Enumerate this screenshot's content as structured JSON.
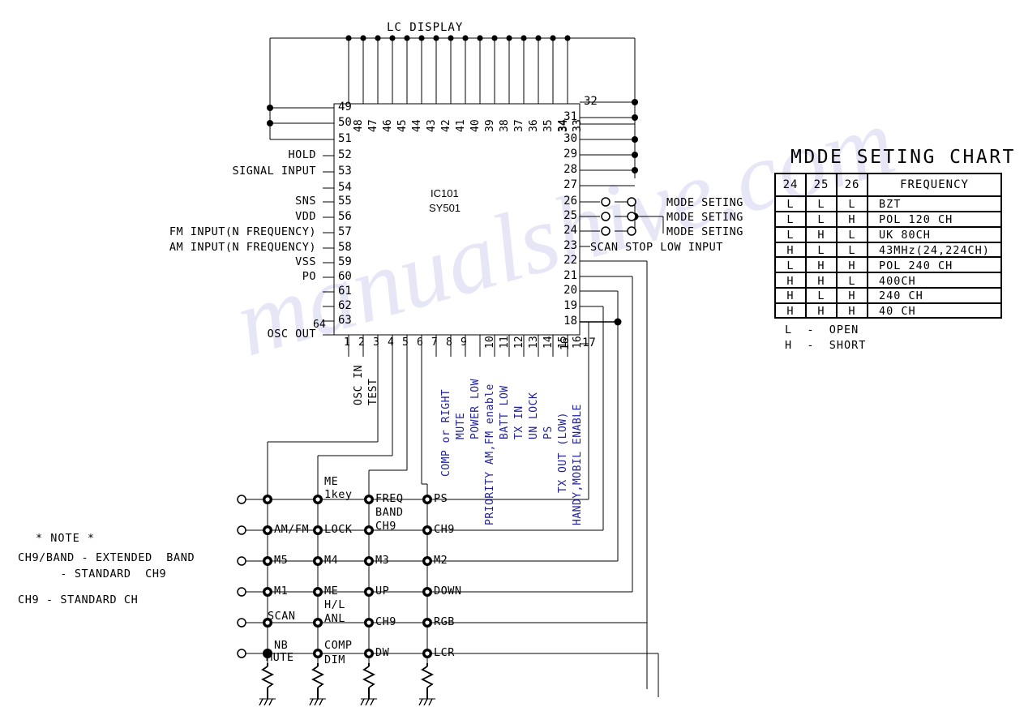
{
  "diagram": {
    "ic": {
      "ref": "IC101",
      "part": "SY501"
    },
    "top_bus_label": "LC DISPLAY"
  },
  "pins_left": [
    {
      "num": "49",
      "label": ""
    },
    {
      "num": "50",
      "label": ""
    },
    {
      "num": "51",
      "label": ""
    },
    {
      "num": "52",
      "label": "HOLD"
    },
    {
      "num": "53",
      "label": "SIGNAL INPUT"
    },
    {
      "num": "54",
      "label": ""
    },
    {
      "num": "55",
      "label": "SNS"
    },
    {
      "num": "56",
      "label": "VDD"
    },
    {
      "num": "57",
      "label": "FM INPUT(N FREQUENCY)"
    },
    {
      "num": "58",
      "label": "AM INPUT(N FREQUENCY)"
    },
    {
      "num": "59",
      "label": "VSS"
    },
    {
      "num": "60",
      "label": "PO"
    },
    {
      "num": "61",
      "label": ""
    },
    {
      "num": "62",
      "label": ""
    },
    {
      "num": "63",
      "label": ""
    },
    {
      "num": "64",
      "label": "OSC OUT"
    }
  ],
  "pins_top": [
    "48",
    "47",
    "46",
    "45",
    "44",
    "43",
    "42",
    "41",
    "40",
    "39",
    "38",
    "37",
    "36",
    "35",
    "34",
    "33"
  ],
  "pins_right": [
    {
      "num": "32",
      "label": ""
    },
    {
      "num": "31",
      "label": ""
    },
    {
      "num": "30",
      "label": ""
    },
    {
      "num": "29",
      "label": ""
    },
    {
      "num": "28",
      "label": ""
    },
    {
      "num": "27",
      "label": ""
    },
    {
      "num": "26",
      "label": "MODE SETING"
    },
    {
      "num": "25",
      "label": "MODE SETING"
    },
    {
      "num": "24",
      "label": "MODE SETING"
    },
    {
      "num": "23",
      "label": "SCAN STOP LOW INPUT"
    },
    {
      "num": "22",
      "label": ""
    },
    {
      "num": "21",
      "label": ""
    },
    {
      "num": "20",
      "label": ""
    },
    {
      "num": "19",
      "label": ""
    },
    {
      "num": "18",
      "label": ""
    },
    {
      "num": "17",
      "label": ""
    }
  ],
  "pins_bottom": [
    {
      "num": "1",
      "label": "OSC IN",
      "color": "black"
    },
    {
      "num": "2",
      "label": "TEST",
      "color": "black"
    },
    {
      "num": "3",
      "label": "",
      "color": "black"
    },
    {
      "num": "4",
      "label": "",
      "color": "black"
    },
    {
      "num": "5",
      "label": "",
      "color": "black"
    },
    {
      "num": "6",
      "label": "",
      "color": "black"
    },
    {
      "num": "7",
      "label": "COMP or RIGHT",
      "color": "blue"
    },
    {
      "num": "8",
      "label": "MUTE",
      "color": "blue"
    },
    {
      "num": "9",
      "label": "POWER LOW",
      "color": "blue"
    },
    {
      "num": "10",
      "label": "PRIORITY AM,FM enable",
      "color": "blue"
    },
    {
      "num": "11",
      "label": "BATT LOW",
      "color": "blue"
    },
    {
      "num": "12",
      "label": "TX IN",
      "color": "blue"
    },
    {
      "num": "13",
      "label": "UN LOCK",
      "color": "blue"
    },
    {
      "num": "14",
      "label": "PS",
      "color": "blue"
    },
    {
      "num": "15",
      "label": "TX OUT (LOW)",
      "color": "blue"
    },
    {
      "num": "16",
      "label": "HANDY,MOBIL ENABLE",
      "color": "blue"
    },
    {
      "num": "17",
      "label": "",
      "color": "black"
    }
  ],
  "keypad": {
    "rows": [
      [
        "",
        "ME\n1key",
        "FREQ",
        "PS"
      ],
      [
        "AM/FM",
        "LOCK",
        "BAND\nCH9",
        "CH9"
      ],
      [
        "M5",
        "M4",
        "M3",
        "M2"
      ],
      [
        "M1",
        "ME",
        "UP",
        "DOWN"
      ],
      [
        "SCAN",
        "H/L\nANL",
        "CH9",
        "RGB"
      ],
      [
        "NB\nMUTE",
        "COMP\nDIM",
        "DW",
        "LCR"
      ]
    ]
  },
  "note": {
    "title": "* NOTE *",
    "lines": [
      "CH9/BAND - EXTENDED  BAND",
      "      - STANDARD  CH9",
      "CH9 - STANDARD CH"
    ]
  },
  "mode_chart": {
    "title": "MDDE SETING CHART",
    "headers": [
      "24",
      "25",
      "26",
      "FREQUENCY"
    ],
    "rows": [
      [
        "L",
        "L",
        "L",
        "BZT"
      ],
      [
        "L",
        "L",
        "H",
        "POL 120 CH"
      ],
      [
        "L",
        "H",
        "L",
        "UK 80CH"
      ],
      [
        "H",
        "L",
        "L",
        "43MHz(24,224CH)"
      ],
      [
        "L",
        "H",
        "H",
        "POL 240 CH"
      ],
      [
        "H",
        "H",
        "L",
        "400CH"
      ],
      [
        "H",
        "L",
        "H",
        "240 CH"
      ],
      [
        "H",
        "H",
        "H",
        "40 CH"
      ]
    ],
    "legend": [
      "L  -  OPEN",
      "H  -  SHORT"
    ]
  }
}
